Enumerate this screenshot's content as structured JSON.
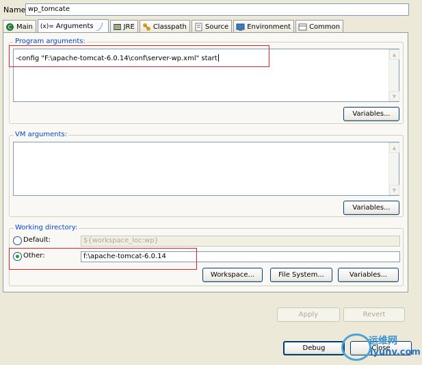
{
  "name": {
    "label": "Name:",
    "value": "wp_tomcate"
  },
  "tabs": [
    {
      "label": "Main",
      "icon": "main-icon",
      "active": false
    },
    {
      "label": "Arguments",
      "icon": "arguments-icon",
      "icon_text": "(x)=",
      "active": true
    },
    {
      "label": "JRE",
      "icon": "jre-icon",
      "active": false
    },
    {
      "label": "Classpath",
      "icon": "classpath-icon",
      "active": false
    },
    {
      "label": "Source",
      "icon": "source-icon",
      "active": false
    },
    {
      "label": "Environment",
      "icon": "environment-icon",
      "active": false
    },
    {
      "label": "Common",
      "icon": "common-icon",
      "active": false
    }
  ],
  "program_arguments": {
    "title": "Program arguments:",
    "value": "-config \"F:\\apache-tomcat-6.0.14\\conf\\server-wp.xml\" start",
    "variables_button": "Variables..."
  },
  "vm_arguments": {
    "title": "VM arguments:",
    "value": "",
    "variables_button": "Variables..."
  },
  "working_directory": {
    "title": "Working directory:",
    "default_label": "Default:",
    "default_value": "${workspace_loc:wp}",
    "other_label": "Other:",
    "other_value": "f:\\apache-tomcat-6.0.14",
    "selected": "other",
    "workspace_button": "Workspace...",
    "filesystem_button": "File System...",
    "variables_button": "Variables..."
  },
  "apply_button": "Apply",
  "revert_button": "Revert",
  "debug_button": "Debug",
  "close_button": "Close",
  "watermark": {
    "cn": "运维网",
    "en": "iyunv.com"
  },
  "colors": {
    "group_title": "#0046d5",
    "highlight": "#e8202a",
    "radio_on": "#21a121"
  }
}
